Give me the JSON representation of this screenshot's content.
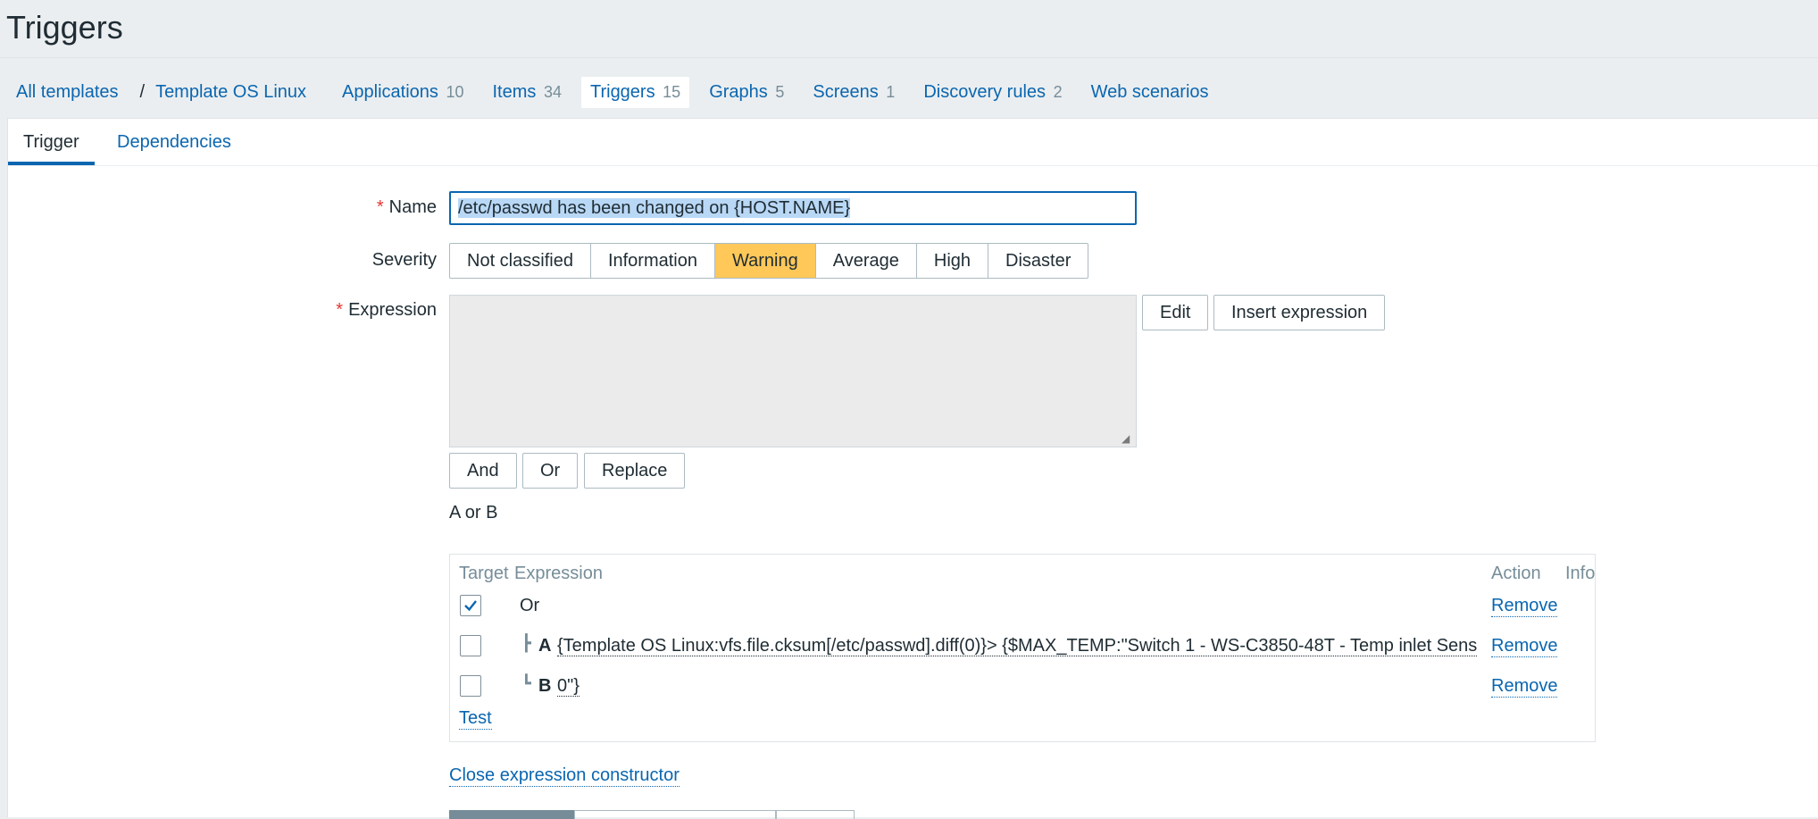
{
  "page": {
    "title": "Triggers"
  },
  "nav": {
    "breadcrumb_root": "All templates",
    "separator": "/",
    "template": "Template OS Linux",
    "items": [
      {
        "label": "Applications",
        "count": "10"
      },
      {
        "label": "Items",
        "count": "34"
      },
      {
        "label": "Triggers",
        "count": "15"
      },
      {
        "label": "Graphs",
        "count": "5"
      },
      {
        "label": "Screens",
        "count": "1"
      },
      {
        "label": "Discovery rules",
        "count": "2"
      },
      {
        "label": "Web scenarios",
        "count": ""
      }
    ],
    "active": "Triggers"
  },
  "tabs": [
    {
      "label": "Trigger",
      "active": true
    },
    {
      "label": "Dependencies",
      "active": false
    }
  ],
  "form": {
    "required_mark": "*",
    "name": {
      "label": "Name",
      "value": "/etc/passwd has been changed on {HOST.NAME}"
    },
    "severity": {
      "label": "Severity",
      "options": [
        "Not classified",
        "Information",
        "Warning",
        "Average",
        "High",
        "Disaster"
      ],
      "selected": "Warning"
    },
    "expression": {
      "label": "Expression",
      "value": "",
      "edit_label": "Edit",
      "insert_label": "Insert expression"
    },
    "logic_buttons": {
      "and": "And",
      "or": "Or",
      "replace": "Replace"
    },
    "constructor_summary": "A or B",
    "constructor": {
      "headers": {
        "target": "Target",
        "expression": "Expression",
        "action": "Action",
        "info": "Info"
      },
      "rows": [
        {
          "checked": true,
          "tree": "",
          "letter": "",
          "expression": "Or",
          "action": "Remove"
        },
        {
          "checked": false,
          "tree": "┣",
          "letter": "A",
          "expression": "{Template OS Linux:vfs.file.cksum[/etc/passwd].diff(0)}> {$MAX_TEMP:\"Switch 1 - WS-C3850-48T - Temp inlet Sens",
          "action": "Remove"
        },
        {
          "checked": false,
          "tree": "┗",
          "letter": "B",
          "expression": "0\"}",
          "action": "Remove"
        }
      ],
      "test_label": "Test"
    },
    "close_constructor": "Close expression constructor"
  },
  "colors": {
    "link": "#0a66b0",
    "selected_severity": "#ffc859",
    "required": "#e33734"
  }
}
